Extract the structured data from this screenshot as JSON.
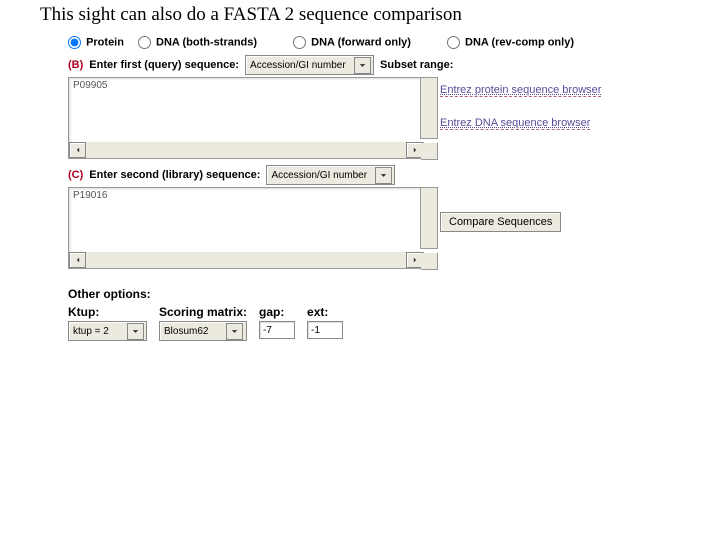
{
  "title": "This sight can also do a FASTA 2 sequence comparison",
  "radios": {
    "protein": "Protein",
    "dna_both": "DNA (both-strands)",
    "dna_fwd": "DNA (forward only)",
    "dna_rev": "DNA (rev-comp only)"
  },
  "sectionB": {
    "marker": "(B)",
    "label": "Enter first (query) sequence:",
    "select": "Accession/GI number",
    "subset": "Subset range:",
    "textarea_value": "P09905"
  },
  "links": {
    "protein_browser": "Entrez protein sequence browser",
    "dna_browser": "Entrez DNA sequence browser"
  },
  "sectionC": {
    "marker": "(C)",
    "label": "Enter second (library) sequence:",
    "select": "Accession/GI number",
    "textarea_value": "P19016"
  },
  "compare_button": "Compare Sequences",
  "other_options_heading": "Other options:",
  "options": {
    "ktup_label": "Ktup:",
    "ktup_value": "ktup = 2",
    "matrix_label": "Scoring matrix:",
    "matrix_value": "Blosum62",
    "gap_label": "gap:",
    "gap_value": "-7",
    "ext_label": "ext:",
    "ext_value": "-1"
  }
}
